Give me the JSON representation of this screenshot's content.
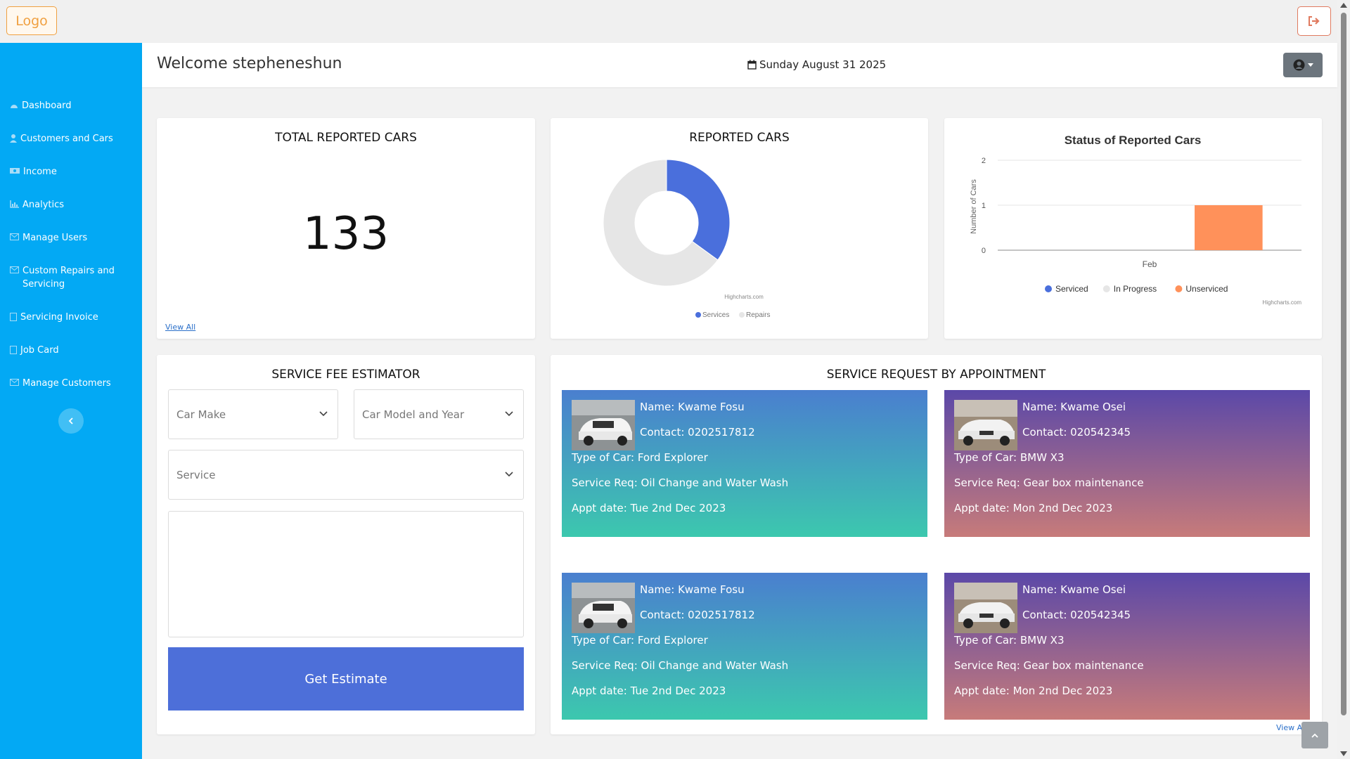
{
  "topbar": {
    "logo_label": "Logo"
  },
  "sidebar": {
    "items": [
      {
        "label": "Dashboard",
        "icon": "dashboard-icon"
      },
      {
        "label": "Customers and Cars",
        "icon": "user-icon"
      },
      {
        "label": "Income",
        "icon": "money-icon"
      },
      {
        "label": "Analytics",
        "icon": "bar-chart-icon"
      },
      {
        "label": "Manage Users",
        "icon": "envelope-icon"
      },
      {
        "label": "Custom Repairs and Servicing",
        "icon": "envelope-icon"
      },
      {
        "label": "Servicing Invoice",
        "icon": "file-icon"
      },
      {
        "label": "Job Card",
        "icon": "file-icon"
      },
      {
        "label": "Manage Customers",
        "icon": "envelope-icon"
      }
    ]
  },
  "header": {
    "welcome": "Welcome stepheneshun",
    "date": "Sunday August 31 2025"
  },
  "total_card": {
    "title": "TOTAL REPORTED CARS",
    "value": "133",
    "link": "View All"
  },
  "chart_data": [
    {
      "type": "pie",
      "title": "REPORTED CARS",
      "credit": "Highcharts.com",
      "series": [
        {
          "name": "Services",
          "value": 35,
          "color": "#4a6fdc"
        },
        {
          "name": "Repairs",
          "value": 65,
          "color": "#e6e6e6"
        }
      ]
    },
    {
      "type": "bar",
      "title": "Status of Reported Cars",
      "ylabel": "Number of Cars",
      "categories": [
        "Feb"
      ],
      "ylim": [
        0,
        2
      ],
      "yticks": [
        "0",
        "1",
        "2"
      ],
      "series": [
        {
          "name": "Serviced",
          "values": [
            0
          ],
          "color": "#4a6fdc"
        },
        {
          "name": "In Progress",
          "values": [
            0
          ],
          "color": "#e6e6e6"
        },
        {
          "name": "Unserviced",
          "values": [
            1
          ],
          "color": "#ff915a"
        }
      ],
      "legend": "bottom",
      "credit": "Highcharts.com"
    }
  ],
  "estimator": {
    "title": "SERVICE FEE ESTIMATOR",
    "car_make_placeholder": "Car Make",
    "car_model_placeholder": "Car Model and Year",
    "service_placeholder": "Service",
    "button": "Get Estimate"
  },
  "appointments": {
    "title": "SERVICE REQUEST BY APPOINTMENT",
    "view_all": "View All",
    "items": [
      {
        "name": "Name: Kwame Fosu",
        "contact": "Contact:  0202517812",
        "car": "Type of Car: Ford Explorer",
        "service": "Service Req: Oil Change and Water Wash",
        "date": "Appt date: Tue 2nd Dec 2023"
      },
      {
        "name": "Name: Kwame Osei",
        "contact": "Contact:  020542345",
        "car": "Type of Car: BMW X3",
        "service": "Service Req: Gear box maintenance",
        "date": "Appt date: Mon 2nd Dec 2023"
      },
      {
        "name": "Name: Kwame Fosu",
        "contact": "Contact:  0202517812",
        "car": "Type of Car: Ford Explorer",
        "service": "Service Req: Oil Change and Water Wash",
        "date": "Appt date: Tue 2nd Dec 2023"
      },
      {
        "name": "Name: Kwame Osei",
        "contact": "Contact:  020542345",
        "car": "Type of Car: BMW X3",
        "service": "Service Req: Gear box maintenance",
        "date": "Appt date: Mon 2nd Dec 2023"
      }
    ]
  }
}
